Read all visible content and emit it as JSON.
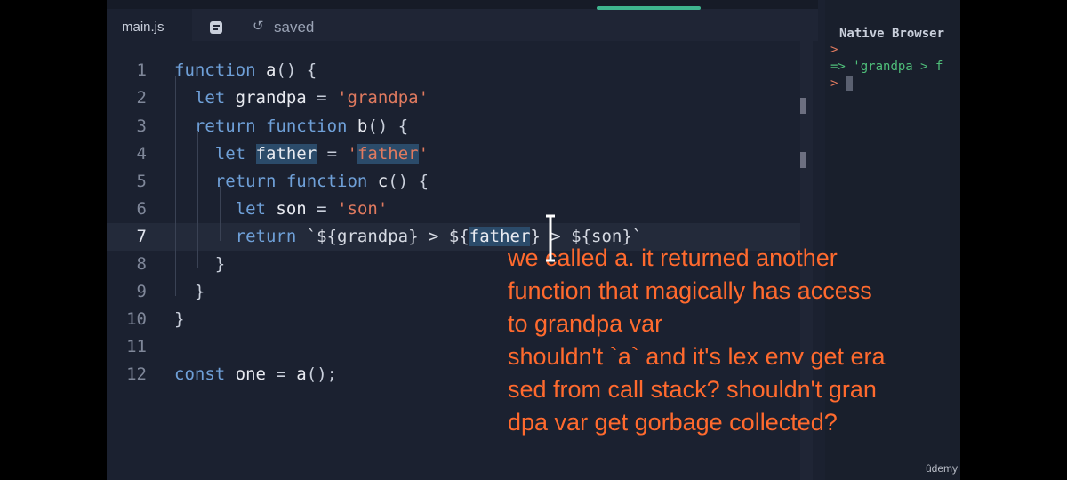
{
  "tab": {
    "filename": "main.js",
    "format_icon": "format-doc-icon",
    "saved_icon": "history-icon",
    "saved_label": "saved"
  },
  "editor": {
    "active_line": 7,
    "lines": [
      {
        "n": "1",
        "tokens": [
          [
            "kw",
            "function "
          ],
          [
            "fn",
            "a"
          ],
          [
            "op",
            "() {"
          ]
        ]
      },
      {
        "n": "2",
        "tokens": [
          [
            "op",
            "  "
          ],
          [
            "kw",
            "let "
          ],
          [
            "fn",
            "grandpa "
          ],
          [
            "op",
            "= "
          ],
          [
            "str",
            "'grandpa'"
          ]
        ]
      },
      {
        "n": "3",
        "tokens": [
          [
            "op",
            "  "
          ],
          [
            "kw",
            "return function "
          ],
          [
            "fn",
            "b"
          ],
          [
            "op",
            "() {"
          ]
        ]
      },
      {
        "n": "4",
        "tokens": [
          [
            "op",
            "    "
          ],
          [
            "kw",
            "let "
          ],
          [
            "hl",
            "father"
          ],
          [
            "op",
            " = "
          ],
          [
            "str",
            "'"
          ],
          [
            "strhl",
            "father"
          ],
          [
            "str",
            "'"
          ]
        ]
      },
      {
        "n": "5",
        "tokens": [
          [
            "op",
            "    "
          ],
          [
            "kw",
            "return function "
          ],
          [
            "fn",
            "c"
          ],
          [
            "op",
            "() {"
          ]
        ]
      },
      {
        "n": "6",
        "tokens": [
          [
            "op",
            "      "
          ],
          [
            "kw",
            "let "
          ],
          [
            "fn",
            "son "
          ],
          [
            "op",
            "= "
          ],
          [
            "str",
            "'son'"
          ]
        ]
      },
      {
        "n": "7",
        "tokens": [
          [
            "op",
            "      "
          ],
          [
            "kw",
            "return "
          ],
          [
            "tpl",
            "`${grandpa} > ${"
          ],
          [
            "hl",
            "father"
          ],
          [
            "tpl",
            "} > ${son}`"
          ]
        ]
      },
      {
        "n": "8",
        "tokens": [
          [
            "op",
            "    }"
          ]
        ]
      },
      {
        "n": "9",
        "tokens": [
          [
            "op",
            "  }"
          ]
        ]
      },
      {
        "n": "10",
        "tokens": [
          [
            "op",
            "}"
          ]
        ]
      },
      {
        "n": "11",
        "tokens": []
      },
      {
        "n": "12",
        "tokens": [
          [
            "kw",
            "const "
          ],
          [
            "fn",
            "one "
          ],
          [
            "op",
            "= "
          ],
          [
            "fn",
            "a"
          ],
          [
            "op",
            "();"
          ]
        ]
      }
    ]
  },
  "console": {
    "title": "Native Browser",
    "prompt1": ">",
    "output_arrow": "=>",
    "output": "'grandpa > f",
    "prompt2": ">"
  },
  "caption": {
    "lines": [
      "we called a. it returned another",
      "function that magically has access",
      "to grandpa var",
      "shouldn't `a` and it's lex env get era",
      "sed from call stack? shouldn't gran",
      "dpa var get gorbage collected?"
    ]
  },
  "watermark": "ûdemy",
  "colors": {
    "keyword": "#6fa0d8",
    "string": "#e07a5f",
    "caption": "#ff6a2e",
    "accent": "#3fb58f"
  }
}
